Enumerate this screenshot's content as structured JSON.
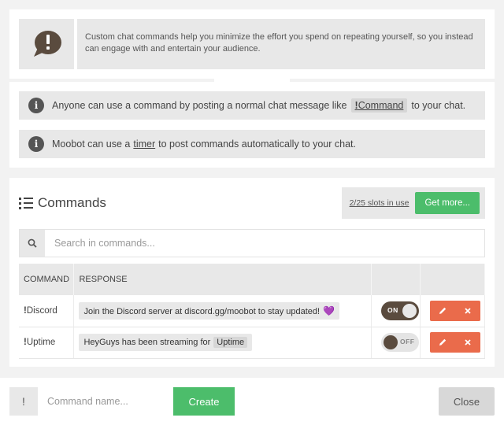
{
  "intro": {
    "icon": "chat-exclamation-icon",
    "text": "Custom chat commands help you minimize the effort you spend on repeating yourself, so you instead can engage with and entertain your audience."
  },
  "info": {
    "line1_before": "Anyone can use a command by posting a normal chat message like",
    "line1_chip_prefix": "!",
    "line1_chip_word": "Command",
    "line1_after": "to your chat.",
    "line2_before": "Moobot can use a",
    "line2_link": "timer",
    "line2_after": "to post commands automatically to your chat."
  },
  "commands": {
    "title": "Commands",
    "slots_text": "2/25 slots in use",
    "get_more_label": "Get more...",
    "search_placeholder": "Search in commands...",
    "columns": [
      "COMMAND",
      "RESPONSE"
    ],
    "rows": [
      {
        "prefix": "!",
        "name": "Discord",
        "response": "Join the Discord server at discord.gg/moobot to stay updated!",
        "var": "",
        "emoji": "💜",
        "toggle": "ON",
        "enabled": true
      },
      {
        "prefix": "!",
        "name": "Uptime",
        "response": "HeyGuys has been streaming for",
        "var": "Uptime",
        "emoji": "",
        "toggle": "OFF",
        "enabled": false
      }
    ]
  },
  "footer": {
    "prefix": "!",
    "placeholder": "Command name...",
    "create_label": "Create",
    "close_label": "Close"
  },
  "colors": {
    "accent_green": "#4cbd6b",
    "action_orange": "#ea6b4b",
    "toggle_brown": "#5a4b3e"
  }
}
